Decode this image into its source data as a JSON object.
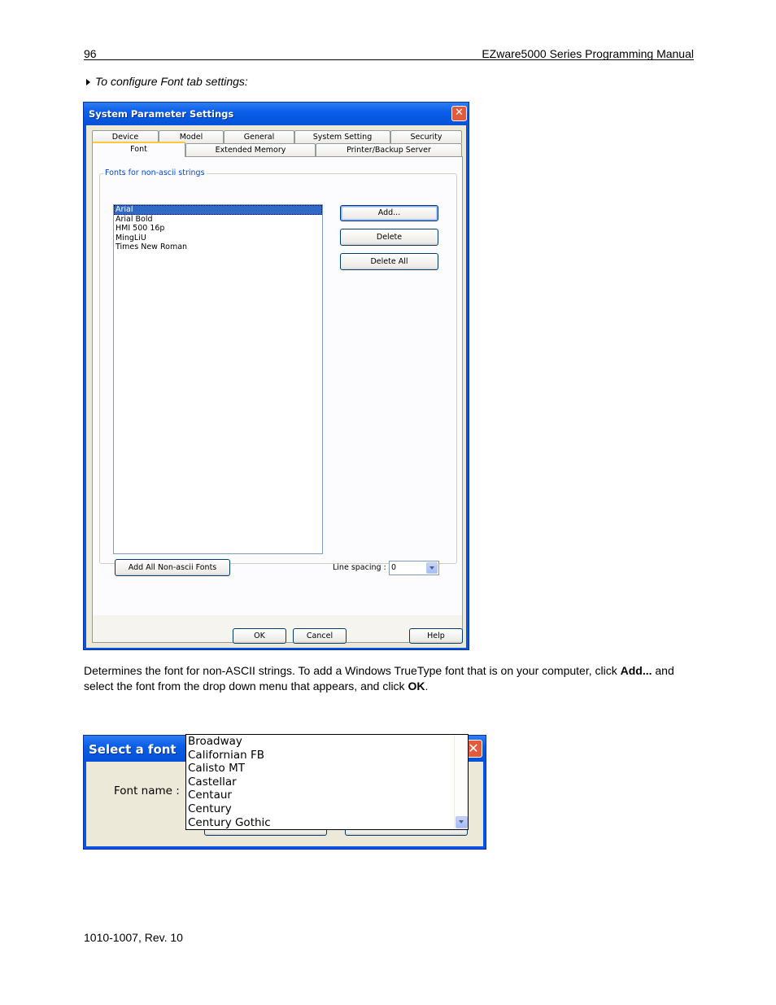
{
  "header": {
    "page_number": "96",
    "manual_title": "EZware5000 Series Programming Manual"
  },
  "step_heading": "To configure Font tab settings:",
  "system_dialog": {
    "title": "System Parameter Settings",
    "tabs_row1": [
      "Device",
      "Model",
      "General",
      "System Setting",
      "Security"
    ],
    "tabs_row2": [
      "Font",
      "Extended Memory",
      "Printer/Backup Server"
    ],
    "active_tab": "Font",
    "group_label": "Fonts for non-ascii strings",
    "font_list": [
      "Arial",
      "Arial Bold",
      "HMI 500 16p",
      "MingLiU",
      "Times New Roman"
    ],
    "selected_font": "Arial",
    "buttons": {
      "add": "Add...",
      "delete": "Delete",
      "delete_all": "Delete All",
      "add_all": "Add All Non-ascii Fonts"
    },
    "line_spacing_label": "Line spacing :",
    "line_spacing_value": "0",
    "footer_buttons": {
      "ok": "OK",
      "cancel": "Cancel",
      "help": "Help"
    }
  },
  "description": {
    "part1": "Determines the font for non-ASCII strings. To add a Windows TrueType font that is on your computer, click ",
    "bold1": "Add...",
    "part2": " and select the font from the drop down menu that appears, and click ",
    "bold2": "OK",
    "part3": "."
  },
  "select_font_dialog": {
    "title": "Select a font",
    "font_name_label": "Font name :",
    "dropdown_items": [
      "Broadway",
      "Californian FB",
      "Calisto MT",
      "Castellar",
      "Centaur",
      "Century",
      "Century Gothic"
    ]
  },
  "footer": {
    "doc_id": "1010-1007, Rev. 10"
  },
  "colors": {
    "title_bar": "#0a5ee8",
    "dialog_face": "#ece9d8",
    "selection": "#316ac5",
    "close_button": "#e35b3d"
  }
}
